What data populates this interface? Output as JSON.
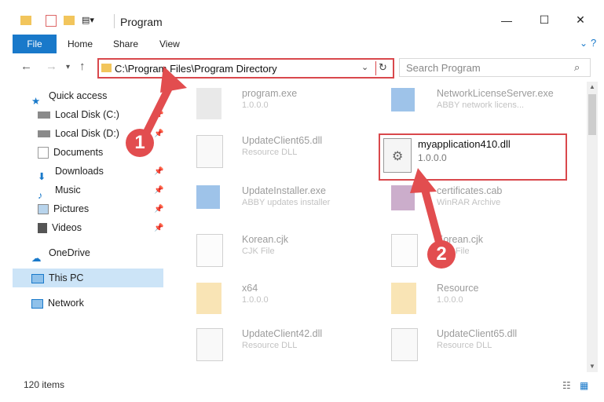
{
  "window": {
    "title": "Program"
  },
  "ribbon": {
    "tabs": [
      "File",
      "Home",
      "Share",
      "View"
    ]
  },
  "address": {
    "path": "C:\\Program Files\\Program Directory",
    "search_placeholder": "Search Program"
  },
  "nav": {
    "items": [
      {
        "label": "Quick access"
      },
      {
        "label": "Local Disk (C:)"
      },
      {
        "label": "Local Disk (D:)"
      },
      {
        "label": "Documents"
      },
      {
        "label": "Downloads"
      },
      {
        "label": "Music"
      },
      {
        "label": "Pictures"
      },
      {
        "label": "Videos"
      },
      {
        "label": "OneDrive"
      },
      {
        "label": "This PC"
      },
      {
        "label": "Network"
      }
    ]
  },
  "files": [
    {
      "name": "program.exe",
      "desc": "1.0.0.0"
    },
    {
      "name": "NetworkLicenseServer.exe",
      "desc": "ABBY network licens..."
    },
    {
      "name": "UpdateClient65.dll",
      "desc": "Resource DLL"
    },
    {
      "name": "myapplication410.dll",
      "desc": "1.0.0.0"
    },
    {
      "name": "UpdateInstaller.exe",
      "desc": "ABBY updates installer"
    },
    {
      "name": "certificates.cab",
      "desc": "WinRAR Archive"
    },
    {
      "name": "Korean.cjk",
      "desc": "CJK File"
    },
    {
      "name": "Korean.cjk",
      "desc": "CJK File"
    },
    {
      "name": "x64",
      "desc": "1.0.0.0"
    },
    {
      "name": "Resource",
      "desc": "1.0.0.0"
    },
    {
      "name": "UpdateClient42.dll",
      "desc": "Resource DLL"
    },
    {
      "name": "UpdateClient65.dll",
      "desc": "Resource DLL"
    }
  ],
  "status": {
    "item_count": "120 items"
  },
  "annotations": {
    "step1": "1",
    "step2": "2"
  },
  "colors": {
    "accent": "#1979ca",
    "highlight": "#d9484c"
  }
}
